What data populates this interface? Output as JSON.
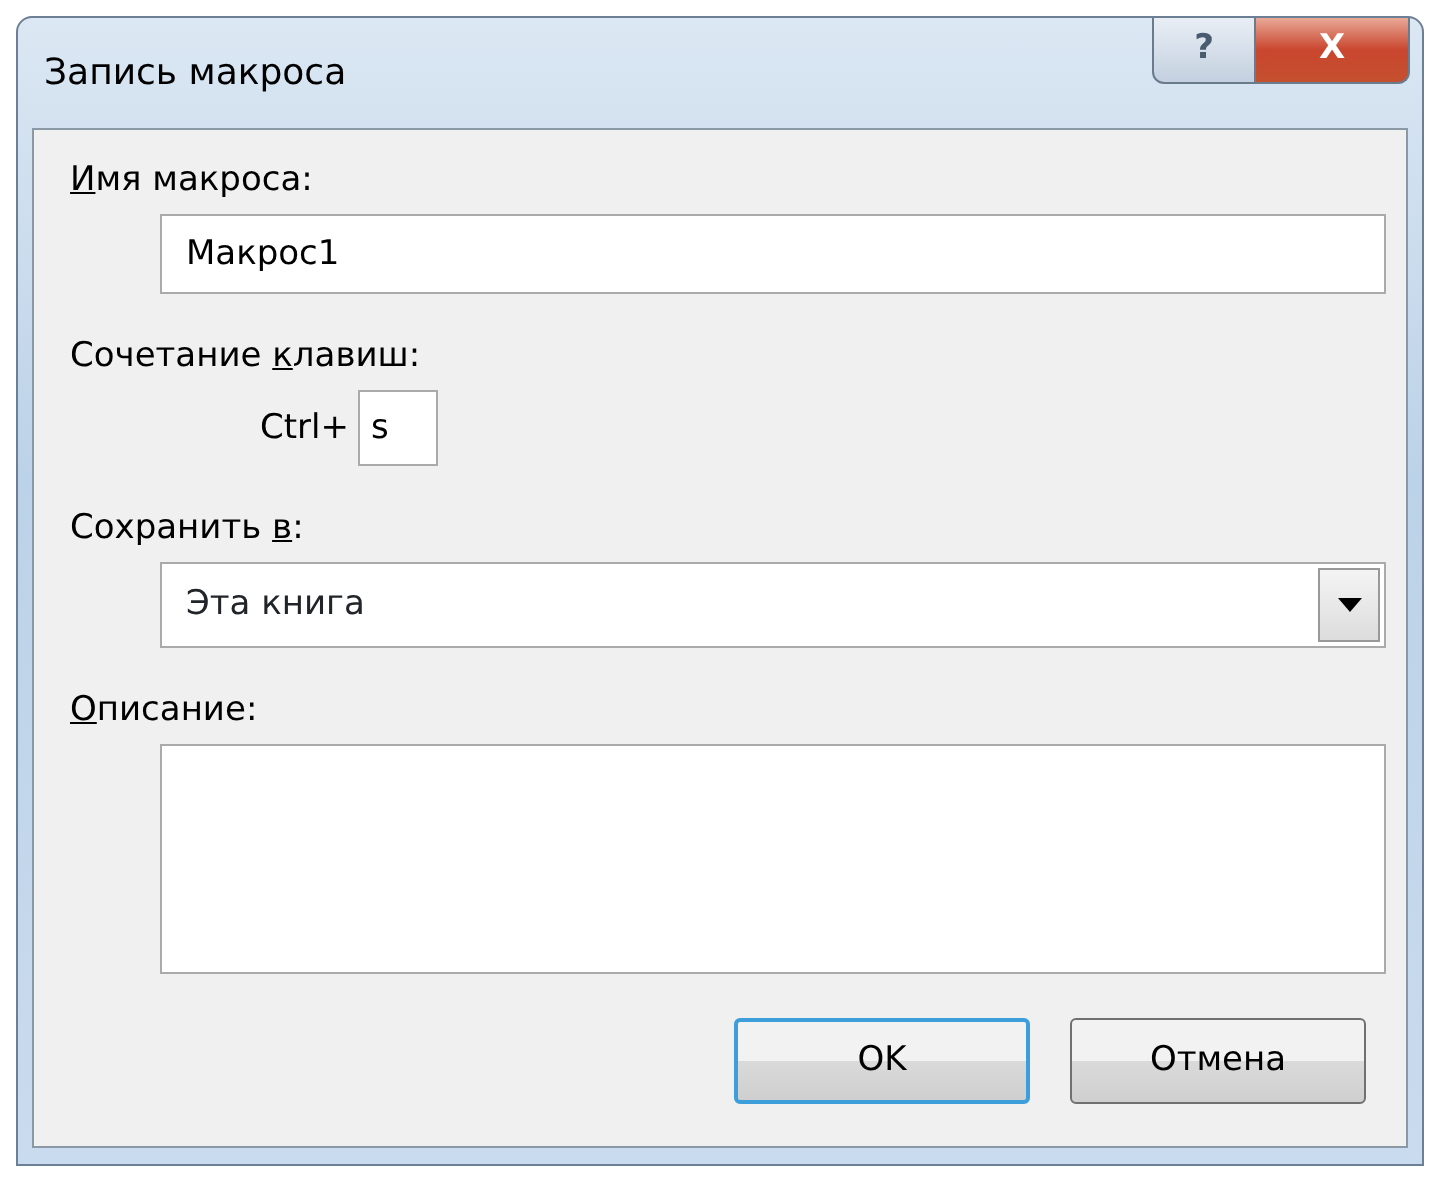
{
  "window": {
    "title": "Запись макроса"
  },
  "title_buttons": [
    {
      "kind": "help",
      "label": "?"
    },
    {
      "kind": "close",
      "label": "X"
    }
  ],
  "fields": [
    {
      "kind": "text",
      "label": {
        "key": "И",
        "after": "мя макроса:"
      },
      "value": "Макрос1"
    },
    {
      "kind": "shortcut",
      "label": {
        "before": "Сочетание ",
        "key": "к",
        "after": "лавиш:"
      },
      "prefix": "Ctrl+",
      "value": "s"
    },
    {
      "kind": "select",
      "label": {
        "before": "Сохранить ",
        "key": "в",
        "after": ":"
      },
      "value": "Эта книга"
    },
    {
      "kind": "textarea",
      "label": {
        "key": "О",
        "after": "писание:"
      }
    }
  ],
  "buttons": [
    {
      "label": "OK",
      "default": true
    },
    {
      "label": "Отмена",
      "default": false
    }
  ]
}
